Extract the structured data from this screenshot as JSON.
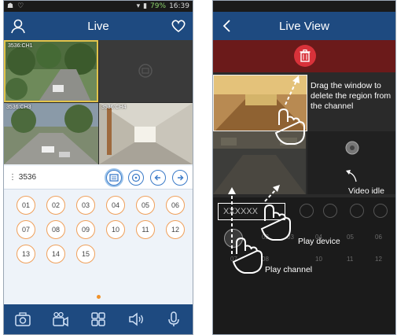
{
  "left_screen": {
    "status": {
      "battery": "79%",
      "time": "16:39"
    },
    "header": {
      "title": "Live"
    },
    "grid": {
      "cells": [
        "3536:CH1",
        "",
        "3536:CH3",
        "3536:CH4"
      ]
    },
    "device": {
      "name": "⋮ 3536"
    },
    "channels": [
      "01",
      "02",
      "03",
      "04",
      "05",
      "06",
      "07",
      "08",
      "09",
      "10",
      "11",
      "12",
      "13",
      "14",
      "15"
    ],
    "toolbar": [
      "camera-icon",
      "video-camera-icon",
      "grid-icon",
      "speaker-icon",
      "microphone-icon"
    ]
  },
  "right_screen": {
    "header": {
      "title": "Live View"
    },
    "annotations": {
      "drag": "Drag the window to delete the region from the channel",
      "idle": "Video idle",
      "play_device": "Play device",
      "play_channel": "Play channel"
    },
    "device_field": "XXXXXX",
    "ghost_numbers": [
      "01",
      "02",
      "03",
      "04",
      "05",
      "06",
      "07",
      "08",
      "09",
      "10",
      "11",
      "12"
    ]
  },
  "colors": {
    "header": "#1e4a80",
    "accent": "#f0a05a",
    "selected": "#e2c34a",
    "trash": "#d8323a"
  }
}
